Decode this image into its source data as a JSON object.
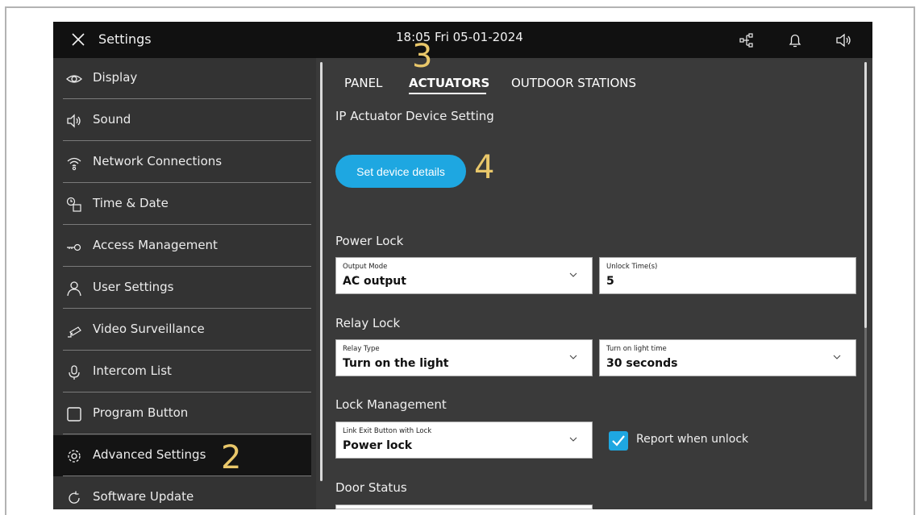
{
  "topbar": {
    "title": "Settings",
    "datetime": "18:05  Fri 05-01-2024",
    "icons": [
      "close-icon",
      "network-topology-icon",
      "bell-icon",
      "speaker-icon"
    ]
  },
  "sidebar": {
    "items": [
      {
        "label": "Display",
        "icon": "eye-icon"
      },
      {
        "label": "Sound",
        "icon": "speaker-icon"
      },
      {
        "label": "Network Connections",
        "icon": "wifi-icon"
      },
      {
        "label": "Time & Date",
        "icon": "clock-calendar-icon"
      },
      {
        "label": "Access Management",
        "icon": "key-icon"
      },
      {
        "label": "User Settings",
        "icon": "user-icon"
      },
      {
        "label": "Video Surveillance",
        "icon": "camera-icon"
      },
      {
        "label": "Intercom List",
        "icon": "microphone-icon"
      },
      {
        "label": "Program Button",
        "icon": "square-icon"
      },
      {
        "label": "Advanced Settings",
        "icon": "gear-icon"
      },
      {
        "label": "Software Update",
        "icon": "refresh-icon"
      }
    ],
    "active": "Advanced Settings"
  },
  "tabs": [
    {
      "label": "PANEL"
    },
    {
      "label": "ACTUATORS"
    },
    {
      "label": "OUTDOOR STATIONS"
    }
  ],
  "active_tab": "ACTUATORS",
  "content": {
    "section_ip": "IP Actuator Device Setting",
    "set_device_button": "Set device details",
    "power_lock": {
      "heading": "Power Lock",
      "output_mode_label": "Output Mode",
      "output_mode_value": "AC output",
      "unlock_time_label": "Unlock Time(s)",
      "unlock_time_value": "5"
    },
    "relay_lock": {
      "heading": "Relay Lock",
      "relay_type_label": "Relay Type",
      "relay_type_value": "Turn on the light",
      "light_time_label": "Turn on light time",
      "light_time_value": "30 seconds"
    },
    "lock_management": {
      "heading": "Lock Management",
      "link_exit_label": "Link Exit Button with Lock",
      "link_exit_value": "Power lock",
      "report_label": "Report when unlock",
      "report_checked": true
    },
    "door_status": {
      "heading": "Door Status"
    }
  },
  "callouts": {
    "two": "2",
    "three": "3",
    "four": "4"
  },
  "colors": {
    "accent": "#1ea7e1",
    "callout": "#e9c76a",
    "background": "#3a3a3a",
    "topbar": "#111111"
  }
}
